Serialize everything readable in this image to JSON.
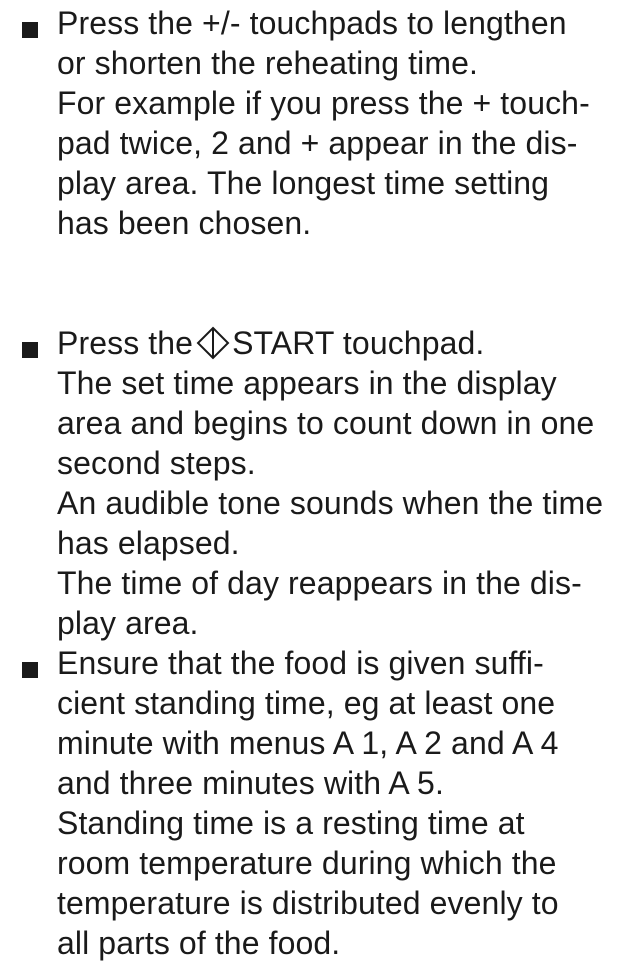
{
  "instructions": [
    {
      "lines": [
        "Press the +/- touchpads to lengthen",
        "or shorten the reheating time.",
        "For example if you press the + touch-",
        "pad twice, 2 and + appear in the dis-",
        "play area. The longest time setting",
        "has been chosen."
      ]
    },
    {
      "first_line_before_icon": "Press the",
      "icon": "start-icon",
      "first_line_after_icon": "START touchpad.",
      "lines": [
        "The set time appears in the display",
        "area and begins to count down in one",
        "second steps.",
        "An audible tone sounds when the time",
        "has elapsed.",
        "The time of day reappears in the dis-",
        "play area."
      ]
    },
    {
      "lines": [
        "Ensure that the food is given suffi-",
        "cient standing time, eg at least one",
        "minute with menus A 1, A 2 and A 4",
        "and three minutes with A 5.",
        "Standing time is a resting time at",
        "room temperature during which the",
        "temperature is distributed evenly to",
        "all parts of the food."
      ]
    }
  ]
}
